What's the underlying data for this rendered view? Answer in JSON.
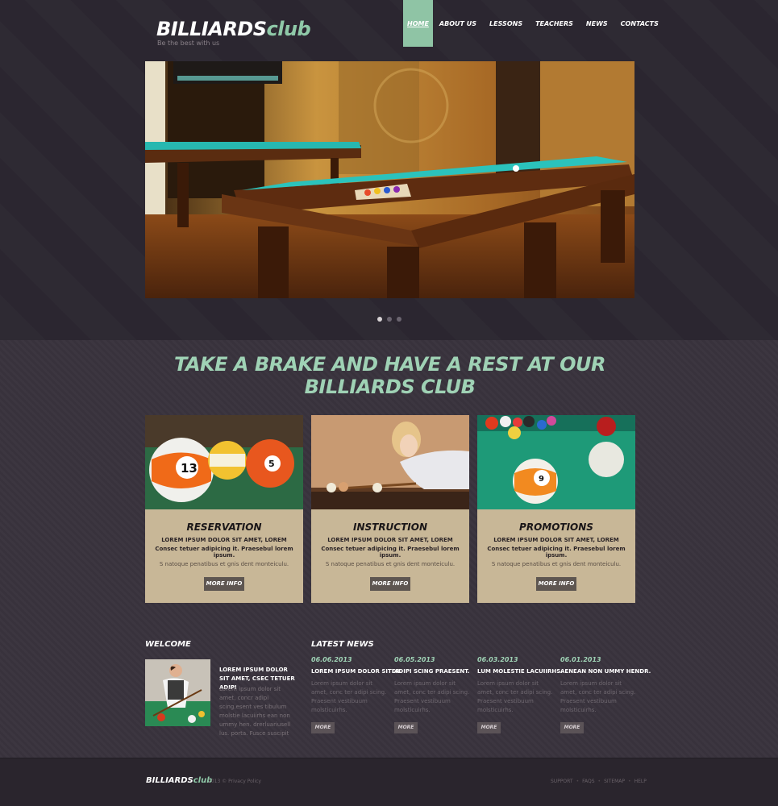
{
  "header": {
    "logo_main": "BILLIARDS",
    "logo_accent": "club",
    "tagline": "Be the best with us",
    "nav": [
      {
        "label": "HOME",
        "active": true
      },
      {
        "label": "ABOUT US"
      },
      {
        "label": "LESSONS"
      },
      {
        "label": "TEACHERS"
      },
      {
        "label": "NEWS"
      },
      {
        "label": "CONTACTS"
      }
    ]
  },
  "slider": {
    "slides": 3,
    "active_index": 0
  },
  "headline": {
    "line1": "TAKE A BRAKE AND HAVE A REST AT OUR",
    "line2": "BILLIARDS CLUB"
  },
  "cards": [
    {
      "title": "RESERVATION",
      "line1": "LOREM IPSUM DOLOR SIT AMET, LOREM",
      "line2": "Consec tetuer adipicing it. Praesebul lorem ipsum.",
      "line3": "S natoque penatibus et gnis dent monteiculu.",
      "button": "MORE INFO"
    },
    {
      "title": "INSTRUCTION",
      "line1": "LOREM IPSUM DOLOR SIT AMET, LOREM",
      "line2": "Consec tetuer adipicing it. Praesebul lorem ipsum.",
      "line3": "S natoque penatibus et gnis dent monteiculu.",
      "button": "MORE INFO"
    },
    {
      "title": "PROMOTIONS",
      "line1": "LOREM IPSUM DOLOR SIT AMET, LOREM",
      "line2": "Consec tetuer adipicing it. Praesebul lorem ipsum.",
      "line3": "S natoque penatibus et gnis dent monteiculu.",
      "button": "MORE INFO"
    }
  ],
  "welcome": {
    "heading": "WELCOME",
    "title": "LOREM IPSUM DOLOR SIT AMET, CSEC TETUER ADIPI",
    "body": "Lorem ipsum dolor sit amet, concr adipi scing.esent ves tibulum molstie lacuiirhs ean non ummy hen. drerluariusell lus. porta. Fusce suscipit"
  },
  "news": {
    "heading": "LATEST NEWS",
    "items": [
      {
        "date": "06.06.2013",
        "title": "LOREM IPSUM DOLOR SITER.",
        "body": "Lorem ipsum dolor sit amet, conc ter adipi scing. Praesent vestibuum molsticuirhs.",
        "button": "MORE"
      },
      {
        "date": "06.05.2013",
        "title": "ADIPI SCING PRAESENT.",
        "body": "Lorem ipsum dolor sit amet, conc ter adipi scing. Praesent vestibuum molsticuirhs.",
        "button": "MORE"
      },
      {
        "date": "06.03.2013",
        "title": "LUM MOLESTIE LACUIIRHS.",
        "body": "Lorem ipsum dolor sit amet, conc ter adipi scing. Praesent vestibuum molsticuirhs.",
        "button": "MORE"
      },
      {
        "date": "06.01.2013",
        "title": "AENEAN NON UMMY HENDR.",
        "body": "Lorem ipsum dolor sit amet, conc ter adipi scing. Praesent vestibuum molsticuirhs.",
        "button": "MORE"
      }
    ]
  },
  "footer": {
    "logo_main": "BILLIARDS",
    "logo_accent": "club",
    "copyright": "2013 © Privacy Policy",
    "links": [
      "SUPPORT",
      "FAQS",
      "SITEMAP",
      "HELP"
    ]
  },
  "colors": {
    "accent": "#8fc4a5",
    "card_bg": "#c8b797",
    "background": "#2b2630"
  }
}
